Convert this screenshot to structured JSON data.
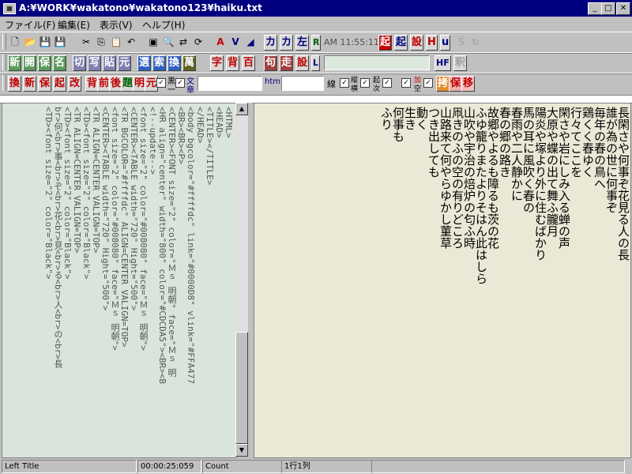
{
  "window": {
    "title": "A:¥WORK¥wakatono¥wakatono123¥haiku.txt"
  },
  "menu": {
    "file": "ファイル(F)",
    "edit": "編集(E)",
    "view": "表示(V)",
    "help": "ヘルプ(H)"
  },
  "toolbar1": {
    "kata1": "カ",
    "kata2": "カ",
    "left": "左",
    "r": "R",
    "clock": "AM 11:55:11",
    "ki1": "起",
    "ki2": "起",
    "setsu": "設",
    "h": "H",
    "u": "u"
  },
  "toolbar2": {
    "shin": "新",
    "kai": "開",
    "ho": "保",
    "mei": "名",
    "kiri": "切",
    "sha": "写",
    "hari": "貼",
    "moto": "元",
    "sen": "選",
    "saku": "索",
    "kan": "換",
    "man": "萬",
    "ji": "字",
    "hai": "背",
    "hyaku": "百",
    "ku": "句",
    "sou": "走",
    "setsu": "設",
    "l": "L",
    "hf": "HF",
    "shaku": "釈"
  },
  "toolbar3": {
    "kan": "換",
    "shin": "新",
    "ho": "保",
    "ki": "起",
    "kai": "改",
    "hai": "背",
    "mae": "前",
    "go": "後",
    "dai": "題",
    "mei": "明",
    "gen": "元",
    "kuro": "黒",
    "ichi": "一",
    "bun": "文",
    "shou": "章",
    "htm": "htm",
    "sen": "線",
    "wa": "縦",
    "yoko": "横",
    "kigou": "起",
    "tsugi": "次",
    "kuwa": "加",
    "kuu": "空",
    "shin2": "拷",
    "ho2": "保",
    "i": "移"
  },
  "editor": {
    "html_source": "<HTML>\n<HEAD>\n<TITLE></TITLE>\n</HEAD>\n<body bgcolor=\"#ffffdc\" link=\"#0000D8\" vlink=\"#FFA477\n<BR><BR><P>\n<CENTER><FONT size=\"2\" color=\"Ｍｓ 明朝\" face=\"Ｍｓ 明\n<HR align=\"center\" width=\"800\" color=\"#CDCDA5\"><BR><B\n<!--update-->\n<font size=\"2\" color=\"#008080\" face=\"Ｍｓ 明朝\">\n<CENTER><TABLE width=\"720\" Hight=\"500\">\n<TR BGCOLOR=\"#ffffdc\" ALIGN=CENTER VALIGN=TOP>\n<font size=\"2\" color=\"#008080\" face=\"Ｍｓ 明朝\">\n<CENTER><TABLE width=\"720\" Hight=\"500\">\n<TR ALIGN=CENTER VALIGN=TOP>\n<TD><font size=\"2\" color=\"Black\">\n<TR ALIGN=CENTER VALIGN=TOP>\n<TD><font size=\"2\" color=\"Black\">\nbr>何<br>事<br>ぞ<br>花<br>見<br>る<br>人<br>の<br>長\n<TD><font size=\"2\" color=\"Black\">",
    "haiku_text": "長閑さや何事ぞ花見る人の長\n誰が為の世に何事ぞ\n毎年の春の鳥へ\n鶏くく春ゆく\n行々てここを\n閑さや岩にしみ入る蝉の声\n大原や蝶の出て舞ふ朧月\n陽炎や塚より外に住むばかり\n馬の耳に風吹く春の\n春雨や二人静かに\n春の郷の路き\n故郷やよるも障るも茨の花\nふゆ籠りまたよりそはん此はしら\n山吹や宇治の焙炉の匂ふ時\n凧きのふの空の有りどころ\n山路来て何やらゆかし菫草\nつき出しても\n動く\n生き\n何事も\nふり"
  },
  "status": {
    "hint": "Left Title",
    "time": "00:00:25:059",
    "count": "Count",
    "pos": "1行1列"
  }
}
